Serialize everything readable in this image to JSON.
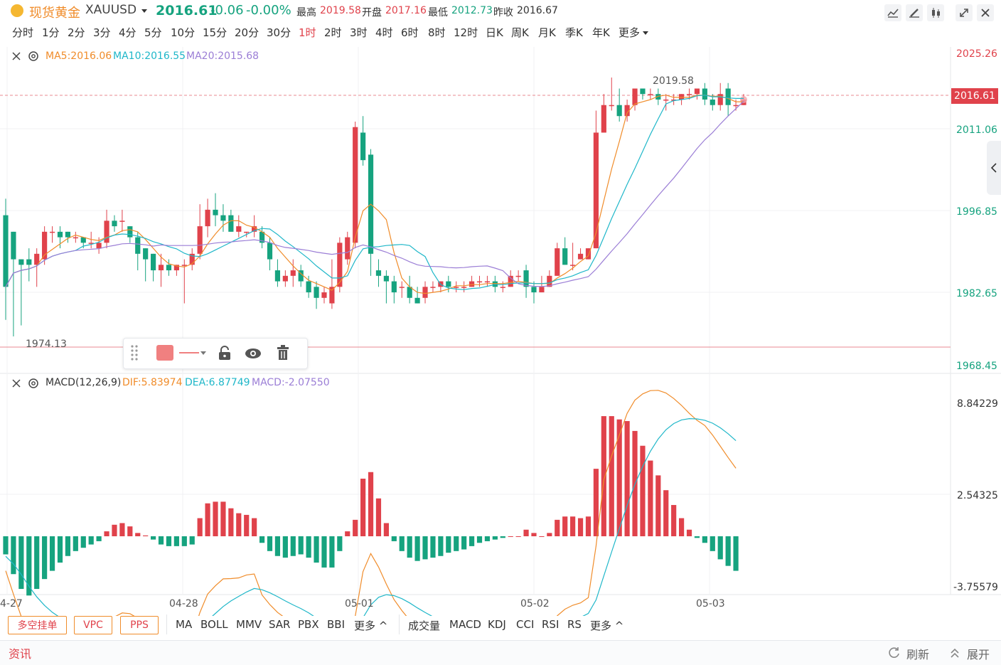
{
  "header": {
    "title": "现货黄金",
    "symbol": "XAUUSD",
    "price": "2016.61",
    "change": "-0.06",
    "change_pct": "-0.00%",
    "high_label": "最高",
    "high": "2019.58",
    "open_label": "开盘",
    "open": "2017.16",
    "low_label": "最低",
    "low": "2012.73",
    "prev_label": "昨收",
    "prev": "2016.67"
  },
  "periods": [
    "分时",
    "1分",
    "2分",
    "3分",
    "4分",
    "5分",
    "10分",
    "15分",
    "20分",
    "30分",
    "1时",
    "2时",
    "3时",
    "4时",
    "6时",
    "8时",
    "12时",
    "日K",
    "周K",
    "月K",
    "季K",
    "年K",
    "更多"
  ],
  "active_period": "1时",
  "main_indicator": {
    "ma5": "MA5:2016.06",
    "ma10": "MA10:2016.55",
    "ma20": "MA20:2015.68"
  },
  "macd_indicator": {
    "name": "MACD(12,26,9)",
    "dif": "DIF:5.83974",
    "dea": "DEA:6.87749",
    "macd": "MACD:-2.07550"
  },
  "price_axis": [
    "2025.26",
    "2011.06",
    "1996.85",
    "1982.65",
    "1968.45"
  ],
  "current_price_tag": "2016.61",
  "macd_axis": [
    "8.84229",
    "2.54325",
    "-3.75579"
  ],
  "annotations": {
    "high": "2019.58",
    "low": "1974.13"
  },
  "dates": [
    "4-27",
    "04-28",
    "05-01",
    "05-02",
    "05-03"
  ],
  "colors": {
    "up": "#e0424b",
    "down": "#16a37f",
    "ma5": "#f08c2a",
    "ma10": "#1fb7c9",
    "ma20": "#9b7ed6"
  },
  "bottom": {
    "buttons": [
      "多空挂单",
      "VPC",
      "PPS"
    ],
    "main_indicators": [
      "MA",
      "BOLL",
      "MMV",
      "SAR",
      "PBX",
      "BBI",
      "更多 ^"
    ],
    "sub_indicators": [
      "成交量",
      "MACD",
      "KDJ",
      "CCI",
      "RSI",
      "RS",
      "更多 ^"
    ]
  },
  "footer": {
    "news": "资讯",
    "refresh": "刷新",
    "expand": "展开"
  },
  "chart_data": {
    "type": "candlestick",
    "ylim": [
      1968.45,
      2025.26
    ],
    "candles": [
      {
        "o": 1996,
        "c": 1983,
        "h": 1999,
        "l": 1977
      },
      {
        "o": 1993,
        "c": 1988,
        "h": 1993,
        "l": 1974
      },
      {
        "o": 1988,
        "c": 1987,
        "h": 1988,
        "l": 1976
      },
      {
        "o": 1988,
        "c": 1987,
        "h": 1990,
        "l": 1984
      },
      {
        "o": 1987,
        "c": 1989,
        "h": 1990,
        "l": 1983
      },
      {
        "o": 1988,
        "c": 1993,
        "h": 1994,
        "l": 1987
      },
      {
        "o": 1993,
        "c": 1993,
        "h": 1994,
        "l": 1991
      },
      {
        "o": 1993,
        "c": 1992,
        "h": 1994,
        "l": 1990
      },
      {
        "o": 1993,
        "c": 1992,
        "h": 1993,
        "l": 1991
      },
      {
        "o": 1992,
        "c": 1992,
        "h": 1993,
        "l": 1991
      },
      {
        "o": 1992,
        "c": 1991,
        "h": 1992,
        "l": 1990
      },
      {
        "o": 1991,
        "c": 1991,
        "h": 1993,
        "l": 1990
      },
      {
        "o": 1990,
        "c": 1991,
        "h": 1992,
        "l": 1989
      },
      {
        "o": 1991,
        "c": 1995,
        "h": 1997,
        "l": 1990
      },
      {
        "o": 1995,
        "c": 1994,
        "h": 1996,
        "l": 1993
      },
      {
        "o": 1995,
        "c": 1995,
        "h": 1997,
        "l": 1993
      },
      {
        "o": 1994,
        "c": 1992,
        "h": 1994,
        "l": 1991
      },
      {
        "o": 1992,
        "c": 1989,
        "h": 1993,
        "l": 1986
      },
      {
        "o": 1990,
        "c": 1988,
        "h": 1990,
        "l": 1984
      },
      {
        "o": 1989,
        "c": 1986,
        "h": 1989,
        "l": 1984
      },
      {
        "o": 1986,
        "c": 1987,
        "h": 1989,
        "l": 1983
      },
      {
        "o": 1987,
        "c": 1986,
        "h": 1988,
        "l": 1985
      },
      {
        "o": 1986,
        "c": 1987,
        "h": 1987,
        "l": 1985
      },
      {
        "o": 1987,
        "c": 1987,
        "h": 1988,
        "l": 1980
      },
      {
        "o": 1987,
        "c": 1989,
        "h": 1990,
        "l": 1986
      },
      {
        "o": 1989,
        "c": 1994,
        "h": 1998,
        "l": 1988
      },
      {
        "o": 1994,
        "c": 1997,
        "h": 1999,
        "l": 1992
      },
      {
        "o": 1997,
        "c": 1996,
        "h": 2000,
        "l": 1994
      },
      {
        "o": 1996,
        "c": 1995,
        "h": 1998,
        "l": 1993
      },
      {
        "o": 1996,
        "c": 1993,
        "h": 1997,
        "l": 1993
      },
      {
        "o": 1993,
        "c": 1994,
        "h": 1996,
        "l": 1992
      },
      {
        "o": 1993,
        "c": 1993,
        "h": 1993,
        "l": 1992
      },
      {
        "o": 1993,
        "c": 1994,
        "h": 1996,
        "l": 1992
      },
      {
        "o": 1993,
        "c": 1991,
        "h": 1994,
        "l": 1990
      },
      {
        "o": 1991,
        "c": 1988,
        "h": 1992,
        "l": 1986
      },
      {
        "o": 1986,
        "c": 1984,
        "h": 1988,
        "l": 1983
      },
      {
        "o": 1984,
        "c": 1985,
        "h": 1986,
        "l": 1983
      },
      {
        "o": 1985,
        "c": 1986,
        "h": 1988,
        "l": 1983
      },
      {
        "o": 1986,
        "c": 1984,
        "h": 1987,
        "l": 1983
      },
      {
        "o": 1984,
        "c": 1982,
        "h": 1985,
        "l": 1981
      },
      {
        "o": 1983,
        "c": 1981,
        "h": 1984,
        "l": 1979
      },
      {
        "o": 1981,
        "c": 1982,
        "h": 1983,
        "l": 1980
      },
      {
        "o": 1980,
        "c": 1983,
        "h": 1988,
        "l": 1979
      },
      {
        "o": 1983,
        "c": 1991,
        "h": 1992,
        "l": 1982
      },
      {
        "o": 1988,
        "c": 1992,
        "h": 1993,
        "l": 1987
      },
      {
        "o": 1991,
        "c": 2012,
        "h": 2013,
        "l": 1990
      },
      {
        "o": 2011,
        "c": 2006,
        "h": 2014,
        "l": 2005
      },
      {
        "o": 2007,
        "c": 1989,
        "h": 2008,
        "l": 1985
      },
      {
        "o": 1986,
        "c": 1985,
        "h": 1988,
        "l": 1983
      },
      {
        "o": 1985,
        "c": 1984,
        "h": 1986,
        "l": 1980
      },
      {
        "o": 1984,
        "c": 1982,
        "h": 1985,
        "l": 1980
      },
      {
        "o": 1983,
        "c": 1983,
        "h": 1984,
        "l": 1981
      },
      {
        "o": 1983,
        "c": 1981,
        "h": 1985,
        "l": 1980
      },
      {
        "o": 1981,
        "c": 1980,
        "h": 1983,
        "l": 1980
      },
      {
        "o": 1981,
        "c": 1983,
        "h": 1984,
        "l": 1980
      },
      {
        "o": 1983,
        "c": 1983,
        "h": 1984,
        "l": 1982
      },
      {
        "o": 1983,
        "c": 1984,
        "h": 1984,
        "l": 1982
      },
      {
        "o": 1984,
        "c": 1983,
        "h": 1985,
        "l": 1982
      },
      {
        "o": 1983,
        "c": 1983,
        "h": 1984,
        "l": 1982
      },
      {
        "o": 1983,
        "c": 1983,
        "h": 1984,
        "l": 1982
      },
      {
        "o": 1983,
        "c": 1984,
        "h": 1985,
        "l": 1983
      },
      {
        "o": 1984,
        "c": 1984,
        "h": 1985,
        "l": 1983
      },
      {
        "o": 1984,
        "c": 1984,
        "h": 1985,
        "l": 1983
      },
      {
        "o": 1984,
        "c": 1983,
        "h": 1985,
        "l": 1982
      },
      {
        "o": 1983,
        "c": 1983,
        "h": 1984,
        "l": 1982
      },
      {
        "o": 1983,
        "c": 1985,
        "h": 1986,
        "l": 1983
      },
      {
        "o": 1985,
        "c": 1985,
        "h": 1986,
        "l": 1984
      },
      {
        "o": 1986,
        "c": 1983,
        "h": 1987,
        "l": 1981
      },
      {
        "o": 1983,
        "c": 1982,
        "h": 1984,
        "l": 1980
      },
      {
        "o": 1982,
        "c": 1983,
        "h": 1985,
        "l": 1982
      },
      {
        "o": 1983,
        "c": 1985,
        "h": 1986,
        "l": 1983
      },
      {
        "o": 1985,
        "c": 1990,
        "h": 1991,
        "l": 1985
      },
      {
        "o": 1990,
        "c": 1987,
        "h": 1992,
        "l": 1987
      },
      {
        "o": 1987,
        "c": 1987,
        "h": 1991,
        "l": 1986
      },
      {
        "o": 1988,
        "c": 1989,
        "h": 1990,
        "l": 1988
      },
      {
        "o": 1988,
        "c": 1990,
        "h": 1990,
        "l": 1988
      },
      {
        "o": 1990,
        "c": 2011,
        "h": 2015,
        "l": 1990
      },
      {
        "o": 2011,
        "c": 2016,
        "h": 2018,
        "l": 2011
      },
      {
        "o": 2016,
        "c": 2016,
        "h": 2021,
        "l": 2015
      },
      {
        "o": 2016,
        "c": 2014,
        "h": 2019,
        "l": 2013
      },
      {
        "o": 2014,
        "c": 2016,
        "h": 2017,
        "l": 2013
      },
      {
        "o": 2016,
        "c": 2019,
        "h": 2019,
        "l": 2015
      },
      {
        "o": 2019,
        "c": 2018,
        "h": 2019,
        "l": 2017
      },
      {
        "o": 2018,
        "c": 2018,
        "h": 2019,
        "l": 2017
      },
      {
        "o": 2018,
        "c": 2017,
        "h": 2019,
        "l": 2016
      },
      {
        "o": 2017,
        "c": 2017,
        "h": 2018,
        "l": 2015
      },
      {
        "o": 2017,
        "c": 2017,
        "h": 2018,
        "l": 2016
      },
      {
        "o": 2017,
        "c": 2018,
        "h": 2018,
        "l": 2016
      },
      {
        "o": 2018,
        "c": 2018,
        "h": 2019,
        "l": 2017
      },
      {
        "o": 2018,
        "c": 2019,
        "h": 2019,
        "l": 2017
      },
      {
        "o": 2019,
        "c": 2017,
        "h": 2020,
        "l": 2016
      },
      {
        "o": 2017,
        "c": 2016,
        "h": 2018,
        "l": 2015
      },
      {
        "o": 2016,
        "c": 2018,
        "h": 2020,
        "l": 2015
      },
      {
        "o": 2019,
        "c": 2016,
        "h": 2020,
        "l": 2014
      },
      {
        "o": 2016,
        "c": 2016,
        "h": 2017,
        "l": 2015
      },
      {
        "o": 2016,
        "c": 2017,
        "h": 2018,
        "l": 2016
      }
    ],
    "macd_hist": [
      -1.1,
      -2.3,
      -3.2,
      -3.6,
      -3.2,
      -2.6,
      -2.1,
      -1.6,
      -1.2,
      -0.9,
      -0.7,
      -0.5,
      -0.3,
      0.3,
      0.7,
      0.8,
      0.6,
      0.2,
      0.05,
      -0.2,
      -0.5,
      -0.6,
      -0.6,
      -0.6,
      -0.5,
      1.1,
      2.0,
      2.1,
      2.1,
      1.7,
      1.4,
      1.3,
      1.1,
      -0.4,
      -0.9,
      -1.2,
      -1.3,
      -1.2,
      -1.1,
      -1.3,
      -1.6,
      -1.9,
      -1.9,
      -0.9,
      0.3,
      1.0,
      3.5,
      3.9,
      2.3,
      0.8,
      -0.3,
      -0.9,
      -1.3,
      -1.5,
      -1.4,
      -1.3,
      -1.2,
      -1.0,
      -0.9,
      -0.8,
      -0.6,
      -0.4,
      -0.3,
      -0.2,
      -0.1,
      0.0,
      0.0,
      0.4,
      0.2,
      0.0,
      0.2,
      1.0,
      1.2,
      1.2,
      1.1,
      1.2,
      4.1,
      7.3,
      7.3,
      7.1,
      7.0,
      6.4,
      5.5,
      4.6,
      3.7,
      2.8,
      1.9,
      1.1,
      0.4,
      -0.1,
      -0.4,
      -0.9,
      -1.4,
      -1.8,
      -2.1
    ]
  }
}
